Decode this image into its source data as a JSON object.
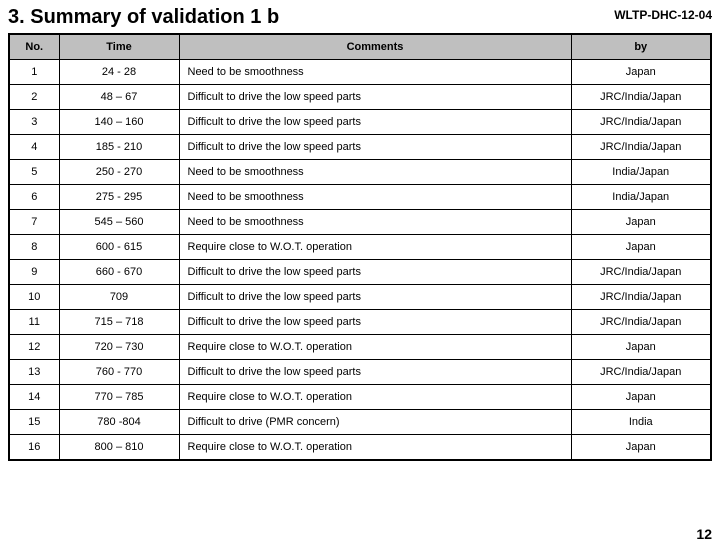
{
  "header": {
    "title": "3. Summary of validation 1 b",
    "doc_id": "WLTP-DHC-12-04"
  },
  "table": {
    "headers": {
      "no": "No.",
      "time": "Time",
      "comments": "Comments",
      "by": "by"
    },
    "rows": [
      {
        "no": "1",
        "time": "24 - 28",
        "comments": "Need to be smoothness",
        "by": "Japan"
      },
      {
        "no": "2",
        "time": "48 – 67",
        "comments": "Difficult to drive the low speed parts",
        "by": "JRC/India/Japan"
      },
      {
        "no": "3",
        "time": "140 – 160",
        "comments": "Difficult to drive the low speed parts",
        "by": "JRC/India/Japan"
      },
      {
        "no": "4",
        "time": "185 - 210",
        "comments": "Difficult to drive the low speed parts",
        "by": "JRC/India/Japan"
      },
      {
        "no": "5",
        "time": "250 - 270",
        "comments": "Need to be smoothness",
        "by": "India/Japan"
      },
      {
        "no": "6",
        "time": "275 - 295",
        "comments": "Need to be smoothness",
        "by": "India/Japan"
      },
      {
        "no": "7",
        "time": "545 – 560",
        "comments": "Need to be smoothness",
        "by": "Japan"
      },
      {
        "no": "8",
        "time": "600 - 615",
        "comments": "Require close to W.O.T. operation",
        "by": "Japan"
      },
      {
        "no": "9",
        "time": "660 - 670",
        "comments": "Difficult to drive the low speed parts",
        "by": "JRC/India/Japan"
      },
      {
        "no": "10",
        "time": "709",
        "comments": "Difficult to drive the low speed parts",
        "by": "JRC/India/Japan"
      },
      {
        "no": "11",
        "time": "715 – 718",
        "comments": "Difficult to drive the low speed parts",
        "by": "JRC/India/Japan"
      },
      {
        "no": "12",
        "time": "720 – 730",
        "comments": "Require close to W.O.T. operation",
        "by": "Japan"
      },
      {
        "no": "13",
        "time": "760 - 770",
        "comments": "Difficult to drive the low speed parts",
        "by": "JRC/India/Japan"
      },
      {
        "no": "14",
        "time": "770 – 785",
        "comments": "Require close to W.O.T. operation",
        "by": "Japan"
      },
      {
        "no": "15",
        "time": "780 -804",
        "comments": "Difficult to drive (PMR concern)",
        "by": "India"
      },
      {
        "no": "16",
        "time": "800 – 810",
        "comments": "Require close to W.O.T. operation",
        "by": "Japan"
      }
    ]
  },
  "page_number": "12"
}
